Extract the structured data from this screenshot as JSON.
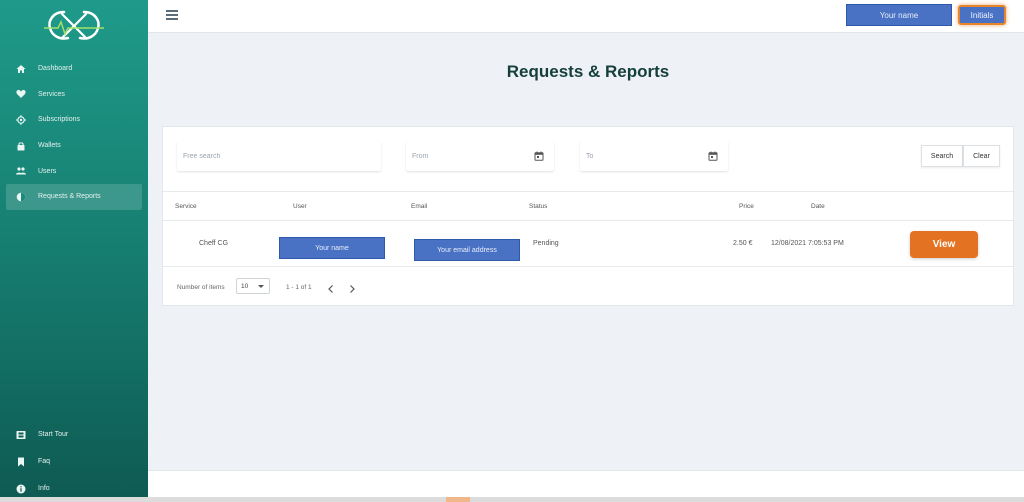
{
  "sidebar": {
    "items": [
      {
        "label": "Dashboard",
        "icon": "home-icon"
      },
      {
        "label": "Services",
        "icon": "heart-icon"
      },
      {
        "label": "Subscriptions",
        "icon": "cog-icon"
      },
      {
        "label": "Wallets",
        "icon": "lock-icon"
      },
      {
        "label": "Users",
        "icon": "users-icon"
      },
      {
        "label": "Requests & Reports",
        "icon": "half-circle-icon",
        "active": true
      }
    ],
    "bottom_items": [
      {
        "label": "Start Tour",
        "icon": "film-icon"
      },
      {
        "label": "Faq",
        "icon": "bookmark-icon"
      },
      {
        "label": "Info",
        "icon": "info-icon"
      }
    ]
  },
  "topbar": {
    "user_button": "Your name",
    "initials_button": "Initials"
  },
  "page": {
    "title": "Requests & Reports"
  },
  "filters": {
    "search_placeholder": "Free search",
    "from_placeholder": "From",
    "to_placeholder": "To",
    "search_button": "Search",
    "clear_button": "Clear"
  },
  "table": {
    "headers": [
      "Service",
      "User",
      "Email",
      "Status",
      "Price",
      "Date"
    ],
    "rows": [
      {
        "service": "Cheff CG",
        "user": "Your name",
        "email": "Your email address",
        "status": "Pending",
        "price": "2.50 €",
        "date": "12/08/2021 7:05:53 PM",
        "action": "View"
      }
    ]
  },
  "pagination": {
    "items_label": "Number of items",
    "page_size": "10",
    "range": "1 - 1 of 1"
  },
  "colors": {
    "sidebar_top": "#1f9a8a",
    "sidebar_bottom": "#0e5a52",
    "accent_orange": "#e37222",
    "placeholder_blue": "#4a72c4",
    "title": "#153f3a"
  }
}
